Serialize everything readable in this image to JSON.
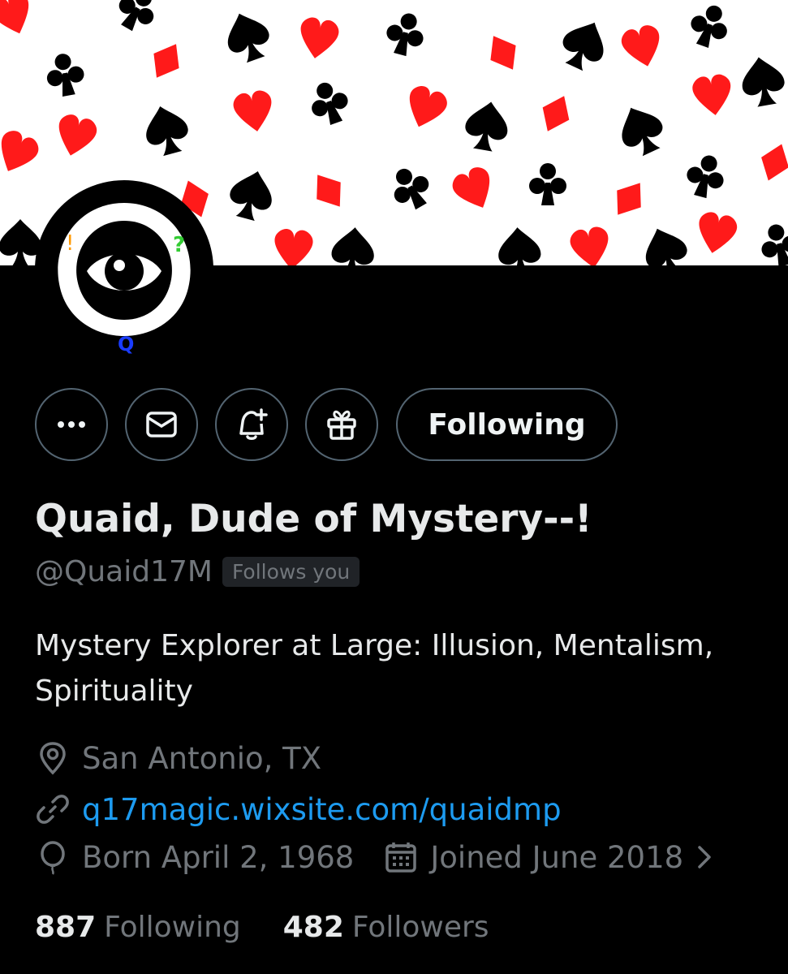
{
  "profile": {
    "display_name": "Quaid, Dude of Mystery--!",
    "handle": "@Quaid17M",
    "follows_you_badge": "Follows you",
    "bio": "Mystery Explorer at Large:  Illusion, Mentalism, Spirituality",
    "location": "San Antonio, TX",
    "website": "q17magic.wixsite.com/quaidmp",
    "birthday": "Born April 2, 1968",
    "joined": "Joined June 2018"
  },
  "avatar": {
    "exclaim": "!",
    "question": "?",
    "letter": "Q"
  },
  "actions": {
    "follow_label": "Following",
    "more_icon": "more-icon",
    "message_icon": "envelope-icon",
    "notify_icon": "bell-plus-icon",
    "gift_icon": "gift-icon"
  },
  "stats": {
    "following_count": "887",
    "following_label": "Following",
    "followers_count": "482",
    "followers_label": "Followers"
  },
  "colors": {
    "background": "#000000",
    "link": "#1d9bf0",
    "muted": "#71767b",
    "banner_red": "#ff1a1a",
    "banner_black": "#000000"
  }
}
